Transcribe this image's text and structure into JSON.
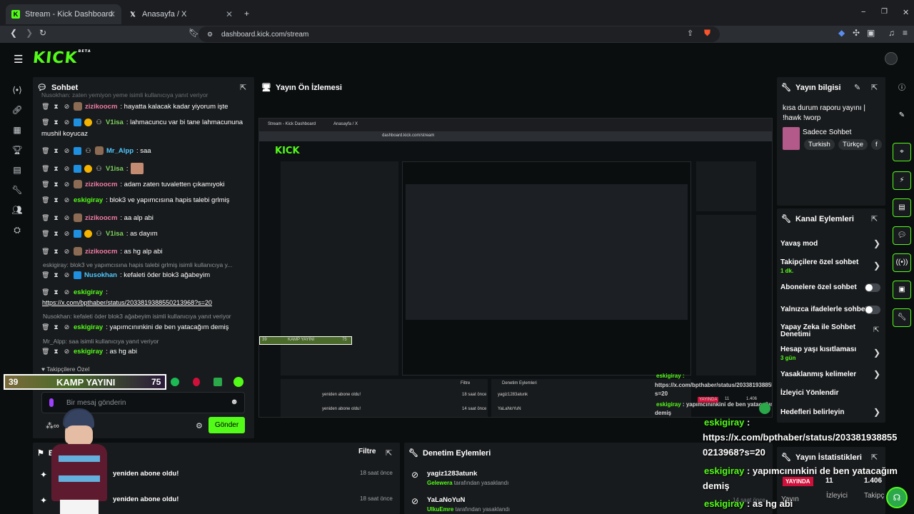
{
  "browser": {
    "tabs": [
      {
        "label": "Stream - Kick Dashboard",
        "active": true
      },
      {
        "label": "Anasayfa / X",
        "active": false
      }
    ],
    "url": "dashboard.kick.com/stream"
  },
  "app": {
    "logo": "KICK",
    "beta": "BETA"
  },
  "chat": {
    "title": "Sohbet",
    "top_partial": "Nusokhan: zaten yemiyon yeme isimli kullanıcıya yanıt veriyor",
    "lines": [
      {
        "user": "zizikoocm",
        "text": ": hayatta kalacak kadar yiyorum işte",
        "color": "#f27ba5"
      },
      {
        "user": "V1isa",
        "text": ": lahmacuncu var bi tane lahmacununa",
        "cont": "mushil koyucaz",
        "color": "#7cd35c"
      },
      {
        "user": "Mr_Alpp",
        "text": ": saa",
        "color": "#4fc8ff"
      },
      {
        "user": "V1isa",
        "text": ":",
        "color": "#7cd35c"
      },
      {
        "user": "zizikoocm",
        "text": ": adam zaten tuvaletten çıkamıyoki",
        "color": "#f27ba5"
      },
      {
        "user": "eskigiray",
        "text": ": blok3 ve yapımcısına hapis talebi grlmiş",
        "color": "#53fc18"
      },
      {
        "user": "zizikoocm",
        "text": ": aa alp abi",
        "color": "#f27ba5"
      },
      {
        "user": "V1isa",
        "text": ": as dayım",
        "color": "#7cd35c"
      },
      {
        "user": "zizikoocm",
        "text": ": as hg alp abi",
        "color": "#f27ba5"
      }
    ],
    "reply1": "eskigiray: blok3 ve yapımcısına hapis talebi grlmiş isimli kullanıcıya y...",
    "nusokhan": {
      "user": "Nusokhan",
      "text": ": kefaleti öder blok3 ağabeyim"
    },
    "eski_link_user": "eskigiray",
    "eski_link_sep": ":",
    "link": "https://x.com/bpthaber/status/2033819388550213968?s=20",
    "reply2": "Nusokhan: kefaleti öder blok3 ağabeyim isimli kullanıcıya yanıt veriyor",
    "eski2": {
      "user": "eskigiray",
      "text": ": yapımcınınkini de ben yatacağım demiş"
    },
    "reply3": "Mr_Alpp: saa isimli kullanıcıya yanıt veriyor",
    "eski3": {
      "user": "eskigiray",
      "text": ": as hg abi"
    },
    "followers_only": "Takipçilere Özel",
    "input_placeholder": "Bir mesaj gönderin",
    "send": "Gönder"
  },
  "overlay": {
    "count_left": "39",
    "camp": "KAMP YAYINI",
    "count_right": "75",
    "big1_user": "eskigiray",
    "big1_sep": " :",
    "big1_link_a": "https://x.com/bpthaber/status/203381938855",
    "big1_link_b": "0213968?s=20",
    "big2_user": "eskigiray",
    "big2_text": " : yapımcınınkini de ben yatacağım",
    "big2_cont": "demiş",
    "big3_user": "eskigiray",
    "big3_text": " : as hg abi"
  },
  "preview": {
    "title": "Yayın Ön İzlemesi",
    "mini_user": "eskigiray :",
    "mini_link": "https://x.com/bpthaber/status/2033819388550213968?s=20",
    "mini_user2": "eskigiray",
    "mini_text2": " : yapımcınınkini de ben yatacağım",
    "mini_cont2": "demiş",
    "live": "YAYINDA",
    "viewers": "11",
    "followers": "1.406",
    "filtre": "Filtre",
    "denetim": "Denetim Eylemleri",
    "user1": "yagiz1283atunk",
    "user2": "YaLaNoYuN",
    "new_sub": "yeniden abone oldu!",
    "mini_time1": "18 saat önce",
    "mini_time2": "14 saat önce"
  },
  "stream_info": {
    "title": "Yayın bilgisi",
    "stream_title": "kısa durum raporu yayını |",
    "stream_title2": "!hawk !worp",
    "category": "Sadece Sohbet",
    "tags": [
      "Turkish",
      "Türkçe",
      "f"
    ]
  },
  "channel_actions": {
    "title": "Kanal Eylemleri",
    "items": [
      {
        "label": "Yavaş mod"
      },
      {
        "label": "Takipçilere özel sohbet",
        "sub": "1 dk."
      },
      {
        "label": "Abonelere özel sohbet"
      },
      {
        "label": "Yalnızca ifadelerle sohbet"
      },
      {
        "label": "Yapay Zeka ile Sohbet Denetimi"
      },
      {
        "label": "Hesap yaşı kısıtlaması",
        "sub": "3 gün"
      },
      {
        "label": "Yasaklanmış kelimeler"
      },
      {
        "label": "İzleyici Yönlendir"
      },
      {
        "label": "Hedefleri belirleyin"
      }
    ]
  },
  "stats": {
    "title": "Yayın İstatistikleri",
    "live": "YAYINDA",
    "viewers_val": "11",
    "followers_val": "1.406",
    "col1": "Yayın",
    "col2": "İzleyici",
    "col3": "Takipç"
  },
  "activity": {
    "title": "Etki",
    "filter": "Filtre",
    "rows": [
      {
        "text": "yeniden abone oldu!",
        "time": "18 saat önce"
      },
      {
        "text": "yeniden abone oldu!",
        "time": "18 saat önce"
      }
    ]
  },
  "moderation": {
    "title": "Denetim Eylemleri",
    "rows": [
      {
        "user": "yagiz1283atunk",
        "by": "Gelewera",
        "action": " tarafından yasaklandı"
      },
      {
        "user": "YaLaNoYuN",
        "by": "UlkuEmre",
        "action": " tarafından yasaklandı"
      }
    ],
    "partial_time": "14 saat önce"
  },
  "colors": {
    "accent": "#53fc18",
    "panel": "#181b1d",
    "background": "#0b0e0f"
  }
}
